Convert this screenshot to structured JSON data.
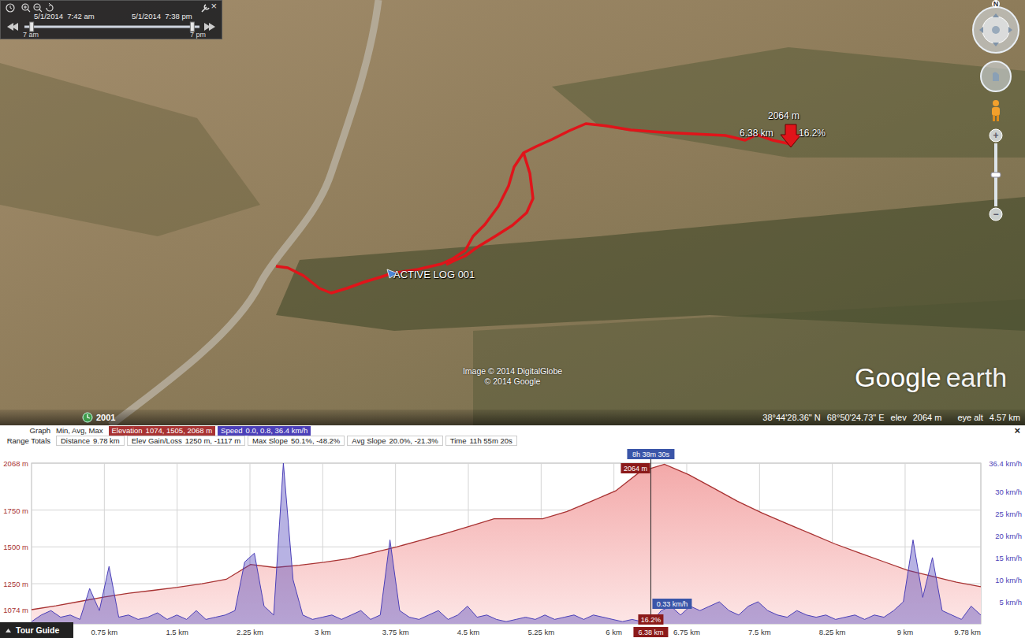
{
  "time_slider": {
    "start": "5/1/2014  7:42 am",
    "end": "5/1/2014  7:38 pm",
    "start_tick": "7 am",
    "end_tick": "7 pm",
    "start_level": 0.03,
    "end_level": 0.97,
    "close": "×"
  },
  "navigation": {
    "compass": "N",
    "zoom_in": "+",
    "zoom_out": "−",
    "zoom_level": 0.5
  },
  "map": {
    "track_label": "ACTIVE LOG 001",
    "cursor": {
      "elevation": "2064 m",
      "distance": "6.38 km",
      "slope": "16.2%"
    },
    "attribution": [
      "Image © 2014 DigitalGlobe",
      "© 2014 Google"
    ],
    "logo": {
      "brand": "Google",
      "product": "earth"
    }
  },
  "status_bar": {
    "imagery_date": "2001",
    "latitude": "38°44'28.36\" N",
    "longitude": "68°50'24.73\" E",
    "elevation_label": "elev",
    "elevation": "2064 m",
    "eye_alt_label": "eye alt",
    "eye_alt": "4.57 km"
  },
  "graph": {
    "title": "Graph",
    "stats_label": "Min, Avg, Max",
    "totals_label": "Range Totals",
    "close": "×",
    "series": [
      {
        "name": "Elevation",
        "stats": "1074, 1505, 2068 m",
        "color": "#a83232",
        "axis": "left",
        "values": [
          1074,
          1100,
          1130,
          1160,
          1185,
          1205,
          1225,
          1250,
          1280,
          1380,
          1360,
          1375,
          1395,
          1420,
          1460,
          1500,
          1545,
          1590,
          1640,
          1690,
          1690,
          1690,
          1740,
          1810,
          1880,
          2010,
          2060,
          1990,
          1900,
          1810,
          1730,
          1660,
          1590,
          1520,
          1460,
          1400,
          1340,
          1300,
          1260,
          1230
        ]
      },
      {
        "name": "Speed",
        "stats": "0.0, 0.8, 36.4 km/h",
        "color": "#4b3fb8",
        "axis": "right",
        "values": [
          0.5,
          2,
          3,
          1.5,
          2,
          1,
          8,
          3,
          13,
          1.5,
          2,
          1,
          1.5,
          2.5,
          1,
          2,
          1,
          3,
          1,
          1.5,
          2,
          3,
          14,
          16,
          4,
          2,
          36.4,
          10,
          2,
          1,
          1.5,
          2,
          1,
          2,
          3,
          1,
          2,
          19,
          3,
          1.5,
          1,
          2,
          3,
          1,
          2,
          4,
          1.5,
          2,
          1,
          0.5,
          1,
          1.5,
          1,
          2,
          1,
          1.5,
          2,
          1,
          2,
          1.5,
          1,
          0.5,
          1,
          0.5,
          0.33,
          3,
          4,
          2,
          4,
          3,
          4,
          5,
          3,
          2,
          4,
          5,
          3,
          2,
          1.5,
          3,
          2,
          1.5,
          2,
          1,
          1.5,
          2,
          1,
          2,
          1.5,
          3,
          5,
          19,
          6,
          15,
          3,
          2,
          1,
          4,
          2
        ]
      }
    ],
    "totals": [
      {
        "label": "Distance",
        "value": "9.78 km"
      },
      {
        "label": "Elev Gain/Loss",
        "value": "1250 m, -1117 m"
      },
      {
        "label": "Max Slope",
        "value": "50.1%, -48.2%"
      },
      {
        "label": "Avg Slope",
        "value": "20.0%, -21.3%"
      },
      {
        "label": "Time",
        "value": "11h 55m 20s"
      }
    ],
    "left_axis": [
      {
        "label": "2068 m",
        "value": 2068
      },
      {
        "label": "1750 m",
        "value": 1750
      },
      {
        "label": "1500 m",
        "value": 1500
      },
      {
        "label": "1250 m",
        "value": 1250
      },
      {
        "label": "1074 m",
        "value": 1074
      }
    ],
    "right_axis": [
      {
        "label": "36.4 km/h",
        "value": 36.4
      },
      {
        "label": "30 km/h",
        "value": 30
      },
      {
        "label": "25 km/h",
        "value": 25
      },
      {
        "label": "20 km/h",
        "value": 20
      },
      {
        "label": "15 km/h",
        "value": 15
      },
      {
        "label": "10 km/h",
        "value": 10
      },
      {
        "label": "5 km/h",
        "value": 5
      }
    ],
    "x_axis": [
      {
        "label": "0.75 km",
        "value": 0.75
      },
      {
        "label": "1.5 km",
        "value": 1.5
      },
      {
        "label": "2.25 km",
        "value": 2.25
      },
      {
        "label": "3 km",
        "value": 3
      },
      {
        "label": "3.75 km",
        "value": 3.75
      },
      {
        "label": "4.5 km",
        "value": 4.5
      },
      {
        "label": "5.25 km",
        "value": 5.25
      },
      {
        "label": "6 km",
        "value": 6
      },
      {
        "label": "6.75 km",
        "value": 6.75
      },
      {
        "label": "7.5 km",
        "value": 7.5
      },
      {
        "label": "8.25 km",
        "value": 8.25
      },
      {
        "label": "9 km",
        "value": 9
      },
      {
        "label": "9.78 km",
        "value": 9.78
      }
    ],
    "cursor": {
      "distance_km": 6.38,
      "distance": "6.38 km",
      "time": "8h 38m 30s",
      "elevation": "2064 m",
      "slope": "16.2%",
      "speed": "0.33 km/h"
    }
  },
  "tour_guide": {
    "label": "Tour Guide"
  }
}
